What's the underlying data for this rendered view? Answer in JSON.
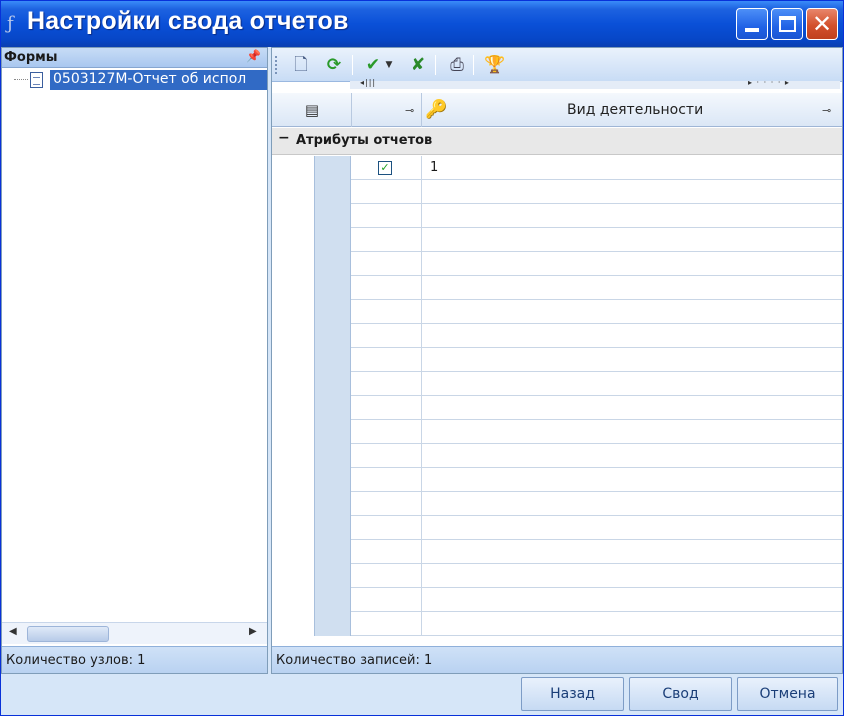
{
  "window": {
    "title": "Настройки свода отчетов",
    "app_icon": "ƒ"
  },
  "left_panel": {
    "header": "Формы",
    "tree_items": [
      {
        "label": "0503127М-Отчет об испол"
      }
    ],
    "status": "Количество узлов: 1"
  },
  "toolbar": {
    "icons": [
      "new-document-icon",
      "refresh-icon",
      "accept-icon",
      "dropdown-arrow-icon",
      "reject-icon",
      "print-icon",
      "trophy-icon"
    ]
  },
  "grid": {
    "column_header": "Вид деятельности",
    "group_label": "Атрибуты отчетов",
    "rows": [
      {
        "checked": true,
        "value": "1"
      }
    ],
    "status": "Количество записей: 1"
  },
  "buttons": {
    "back": "Назад",
    "svod": "Свод",
    "cancel": "Отмена"
  },
  "colors": {
    "titlebar": "#0a50d8",
    "selection": "#316ac5",
    "panel_bg": "#d6e6f8"
  }
}
